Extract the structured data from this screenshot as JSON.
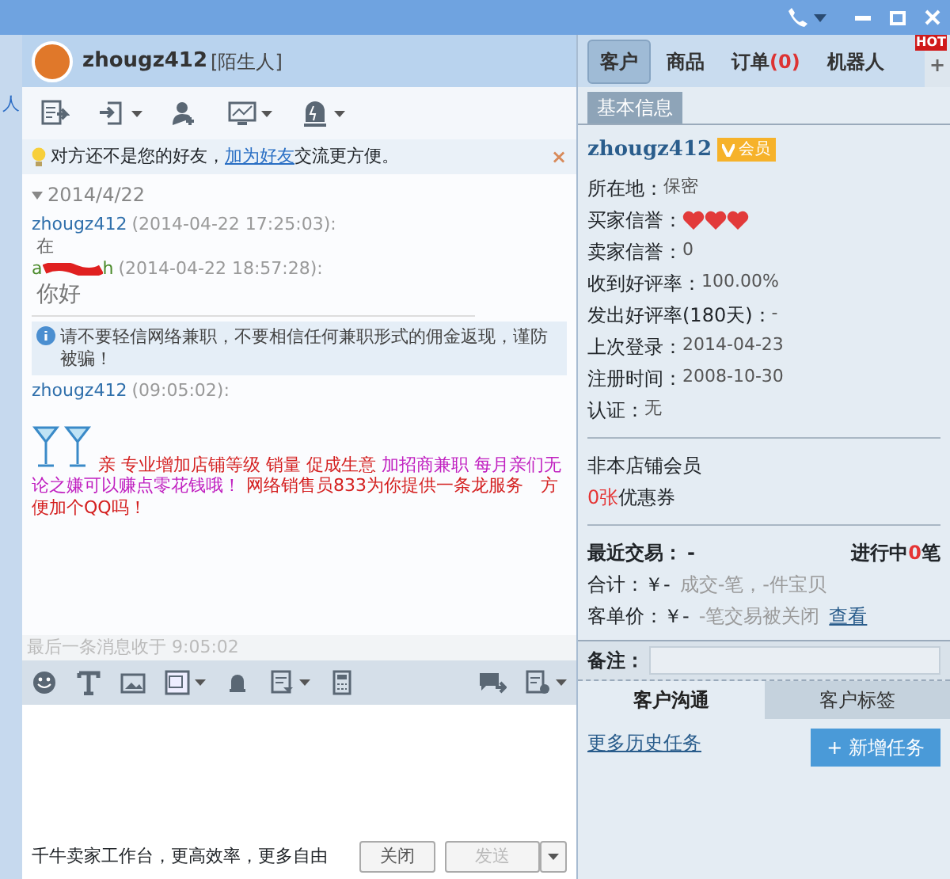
{
  "sidebar": {
    "label": "人"
  },
  "chat": {
    "contact": {
      "name": "zhougz412",
      "tag": "[陌生人]"
    },
    "notice": {
      "before": "对方还不是您的好友，",
      "link": "加为好友",
      "after": "交流更方便。",
      "close": "×"
    },
    "log": [
      {
        "kind": "date",
        "text": "2014/4/22"
      },
      {
        "kind": "message",
        "sender": "zhougz412",
        "time": "(2014-04-22 17:25:03):",
        "text": "在"
      },
      {
        "kind": "own",
        "sender_start": "a",
        "sender_end": "h",
        "time": "(2014-04-22 18:57:28):",
        "text": "你好"
      },
      {
        "kind": "warning",
        "text": "请不要轻信网络兼职，不要相信任何兼职形式的佣金返现，谨防被骗！"
      },
      {
        "kind": "ad",
        "sender": "zhougz412",
        "time": "(09:05:02):",
        "segments": [
          {
            "text": "亲 专业增加店铺等级 销量 促成生意 ",
            "color": "#d42020"
          },
          {
            "text": "加招商兼职 每月亲们无论之嫌可以赚点零花钱哦！",
            "color": "#c020c0"
          },
          {
            "text": " 网络销售员833为你提供一条龙服务　方便加个QQ吗！",
            "color": "#d42020"
          }
        ]
      }
    ],
    "last_received": "最后一条消息收于 9:05:02",
    "footer": "千牛卖家工作台，更高效率，更多自由",
    "close_button": "关闭",
    "send_button": {
      "label": "发送",
      "disabled": true
    }
  },
  "panel": {
    "tabs": [
      {
        "label": "客户",
        "selected": true
      },
      {
        "label": "商品",
        "selected": false
      },
      {
        "label": "订单",
        "count": "(0)",
        "selected": false
      },
      {
        "label": "机器人",
        "selected": false
      }
    ],
    "hot_badge": "HOT",
    "add_tab": "+",
    "subtab": "基本信息",
    "customer": {
      "name": "zhougz412",
      "badge": "会员"
    },
    "fields": [
      {
        "kind": "text",
        "label": "所在地：",
        "value": "保密"
      },
      {
        "kind": "hearts",
        "label": "买家信誉：",
        "stars": 3
      },
      {
        "kind": "text",
        "label": "卖家信誉：",
        "value": "0"
      },
      {
        "kind": "text",
        "label": "收到好评率：",
        "value": "100.00%"
      },
      {
        "kind": "text",
        "label": "发出好评率(180天)：",
        "value": "-"
      },
      {
        "kind": "text",
        "label": "上次登录：",
        "value": "2014-04-23"
      },
      {
        "kind": "text",
        "label": "注册时间：",
        "value": "2008-10-30"
      },
      {
        "kind": "text",
        "label": "认证：",
        "value": "无"
      }
    ],
    "membership": "非本店铺会员",
    "coupon": {
      "count": "0张",
      "text": "优惠券"
    },
    "trade": {
      "label": "最近交易：",
      "value": "-",
      "ongoing_before": "进行中",
      "ongoing_count": "0",
      "ongoing_after": "笔",
      "total_label": "合计：",
      "total": "￥-",
      "total_detail": "成交-笔，-件宝贝",
      "avg_label": "客单价：",
      "avg": "￥-",
      "closed": "-笔交易被关闭",
      "view_link": "查看"
    },
    "note_label": "备注：",
    "bottom_tabs": [
      {
        "label": "客户沟通",
        "selected": true
      },
      {
        "label": "客户标签",
        "selected": false
      }
    ],
    "more_link": "更多历史任务",
    "add_task": "+ 新增任务"
  }
}
